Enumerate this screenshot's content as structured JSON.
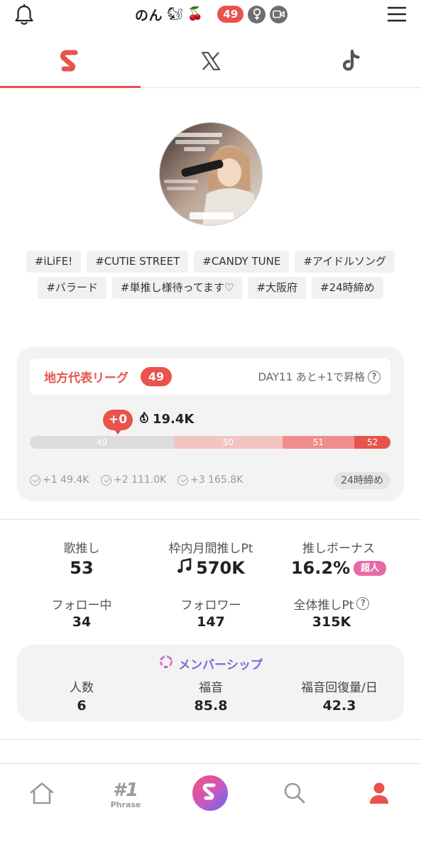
{
  "header": {
    "name": "のん",
    "emoji_1": "🐿",
    "emoji_2": "🍒",
    "badge": "49",
    "icons": [
      "bell-icon",
      "female-icon",
      "video-icon",
      "menu-icon"
    ]
  },
  "tabs": [
    {
      "icon": "app-logo-icon",
      "active": true
    },
    {
      "icon": "x-logo-icon",
      "active": false
    },
    {
      "icon": "tiktok-logo-icon",
      "active": false
    }
  ],
  "tags_row1": [
    "#iLiFE!",
    "#CUTIE STREET",
    "#CANDY TUNE",
    "#アイドルソング"
  ],
  "tags_row2": [
    "#バラード",
    "#単推し様待ってます♡",
    "#大阪府",
    "#24時締め"
  ],
  "league": {
    "name": "地方代表リーグ",
    "rank": "49",
    "day_text": "DAY11 あと+1で昇格",
    "delta": "+0",
    "score": "19.4K",
    "progress_fraction": 0.0,
    "segments": [
      {
        "label": "49",
        "color": "#dcdcdc",
        "weight": 0.4
      },
      {
        "label": "50",
        "color": "#f3c4c2",
        "weight": 0.3
      },
      {
        "label": "51",
        "color": "#ef8f8b",
        "weight": 0.2
      },
      {
        "label": "52",
        "color": "#e8534c",
        "weight": 0.1
      }
    ],
    "gaps": [
      "+1 49.4K",
      "+2 111.0K",
      "+3 165.8K"
    ],
    "deadline": "24時締め"
  },
  "stats": {
    "song_push_label": "歌推し",
    "song_push_value": "53",
    "monthly_label": "枠内月間推しPt",
    "monthly_value": "570K",
    "bonus_label": "推しボーナス",
    "bonus_value": "16.2%",
    "bonus_badge": "超人",
    "following_label": "フォロー中",
    "following_value": "34",
    "followers_label": "フォロワー",
    "followers_value": "147",
    "total_label": "全体推しPt",
    "total_value": "315K"
  },
  "membership": {
    "title": "メンバーシップ",
    "members_label": "人数",
    "members_value": "6",
    "gospel_label": "福音",
    "gospel_value": "85.8",
    "recovery_label": "福音回復量/日",
    "recovery_value": "42.3"
  },
  "nav": {
    "phrase_rank": "#1",
    "phrase_label": "Phrase",
    "items": [
      "home-icon",
      "phrase-icon",
      "app-logo-icon",
      "search-icon",
      "profile-icon"
    ]
  },
  "colors": {
    "accent": "#e8534c",
    "super_badge": "#e66aa8",
    "membership": "#8566d8"
  }
}
